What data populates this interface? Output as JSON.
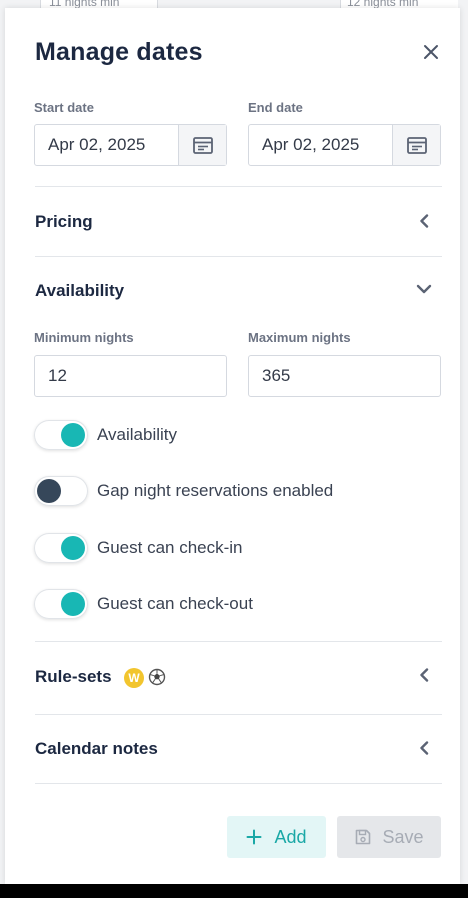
{
  "background": {
    "left_text": "11 nights min",
    "right_text": "12 nights min"
  },
  "panel": {
    "title": "Manage dates",
    "close_icon": "close-icon"
  },
  "dates": {
    "start_label": "Start date",
    "start_value": "Apr 02, 2025",
    "end_label": "End date",
    "end_value": "Apr 02, 2025",
    "calendar_icon": "calendar-icon"
  },
  "sections": {
    "pricing": "Pricing",
    "availability": "Availability",
    "rule_sets": "Rule-sets",
    "rule_sets_badge": "W",
    "calendar_notes": "Calendar notes"
  },
  "availability": {
    "min_label": "Minimum nights",
    "min_value": "12",
    "max_label": "Maximum nights",
    "max_value": "365",
    "toggles": [
      {
        "label": "Availability",
        "on": true
      },
      {
        "label": "Gap night reservations enabled",
        "on": false
      },
      {
        "label": "Guest can check-in",
        "on": true
      },
      {
        "label": "Guest can check-out",
        "on": true
      }
    ]
  },
  "actions": {
    "add_label": "Add",
    "save_label": "Save"
  },
  "colors": {
    "accent": "#18b7b4",
    "toggle_off": "#36475a",
    "badge": "#f2c52e",
    "title": "#1c2841"
  }
}
